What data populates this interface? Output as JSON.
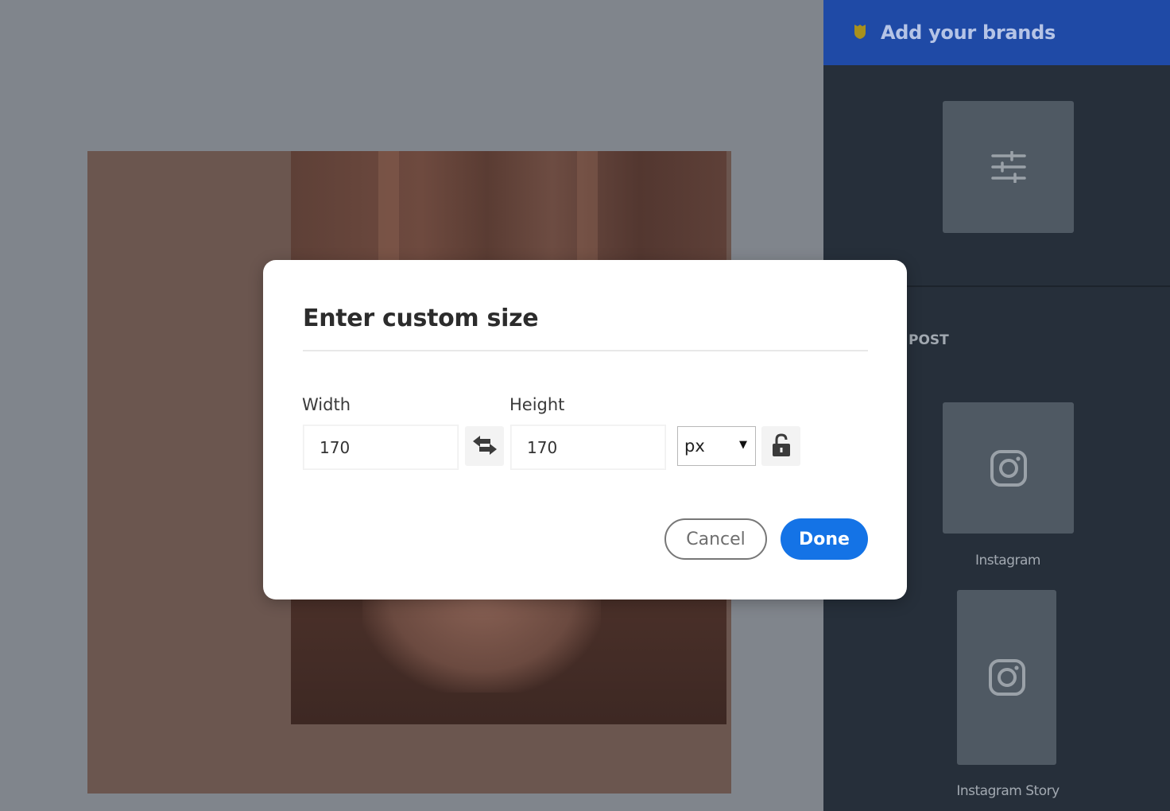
{
  "brand_bar": {
    "title": "Add your brands",
    "icon": "brand-shield-icon"
  },
  "right_panel": {
    "custom_size_tile_icon": "sliders-icon",
    "section_label": "POST",
    "templates": [
      {
        "label": "Instagram",
        "icon": "instagram-icon"
      },
      {
        "label": "Instagram Story",
        "icon": "instagram-icon"
      }
    ]
  },
  "dialog": {
    "title": "Enter custom size",
    "width_label": "Width",
    "width_value": "170",
    "height_label": "Height",
    "height_value": "170",
    "swap_icon": "swap-arrows-icon",
    "unit": "px",
    "lock_icon": "unlock-icon",
    "cancel_label": "Cancel",
    "done_label": "Done"
  },
  "colors": {
    "brand_bar": "#1f4aa6",
    "panel_bg": "#262f3a",
    "canvas_bg": "#80858c",
    "done_button": "#1473e6",
    "brand_icon": "#a8901c"
  }
}
